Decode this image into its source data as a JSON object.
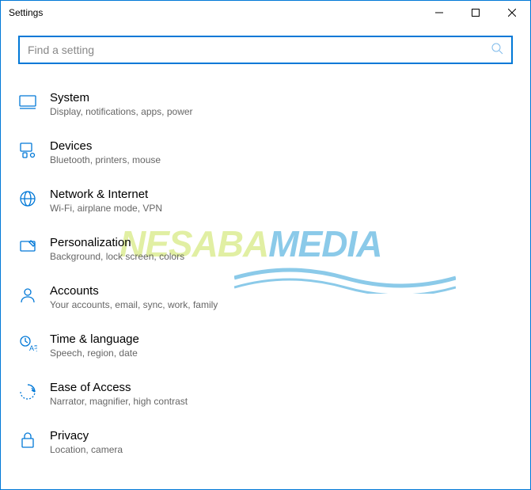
{
  "window": {
    "title": "Settings"
  },
  "search": {
    "placeholder": "Find a setting"
  },
  "items": [
    {
      "title": "System",
      "desc": "Display, notifications, apps, power"
    },
    {
      "title": "Devices",
      "desc": "Bluetooth, printers, mouse"
    },
    {
      "title": "Network & Internet",
      "desc": "Wi-Fi, airplane mode, VPN"
    },
    {
      "title": "Personalization",
      "desc": "Background, lock screen, colors"
    },
    {
      "title": "Accounts",
      "desc": "Your accounts, email, sync, work, family"
    },
    {
      "title": "Time & language",
      "desc": "Speech, region, date"
    },
    {
      "title": "Ease of Access",
      "desc": "Narrator, magnifier, high contrast"
    },
    {
      "title": "Privacy",
      "desc": "Location, camera"
    }
  ],
  "watermark": {
    "part1": "NESABA",
    "part2": "MEDIA"
  }
}
